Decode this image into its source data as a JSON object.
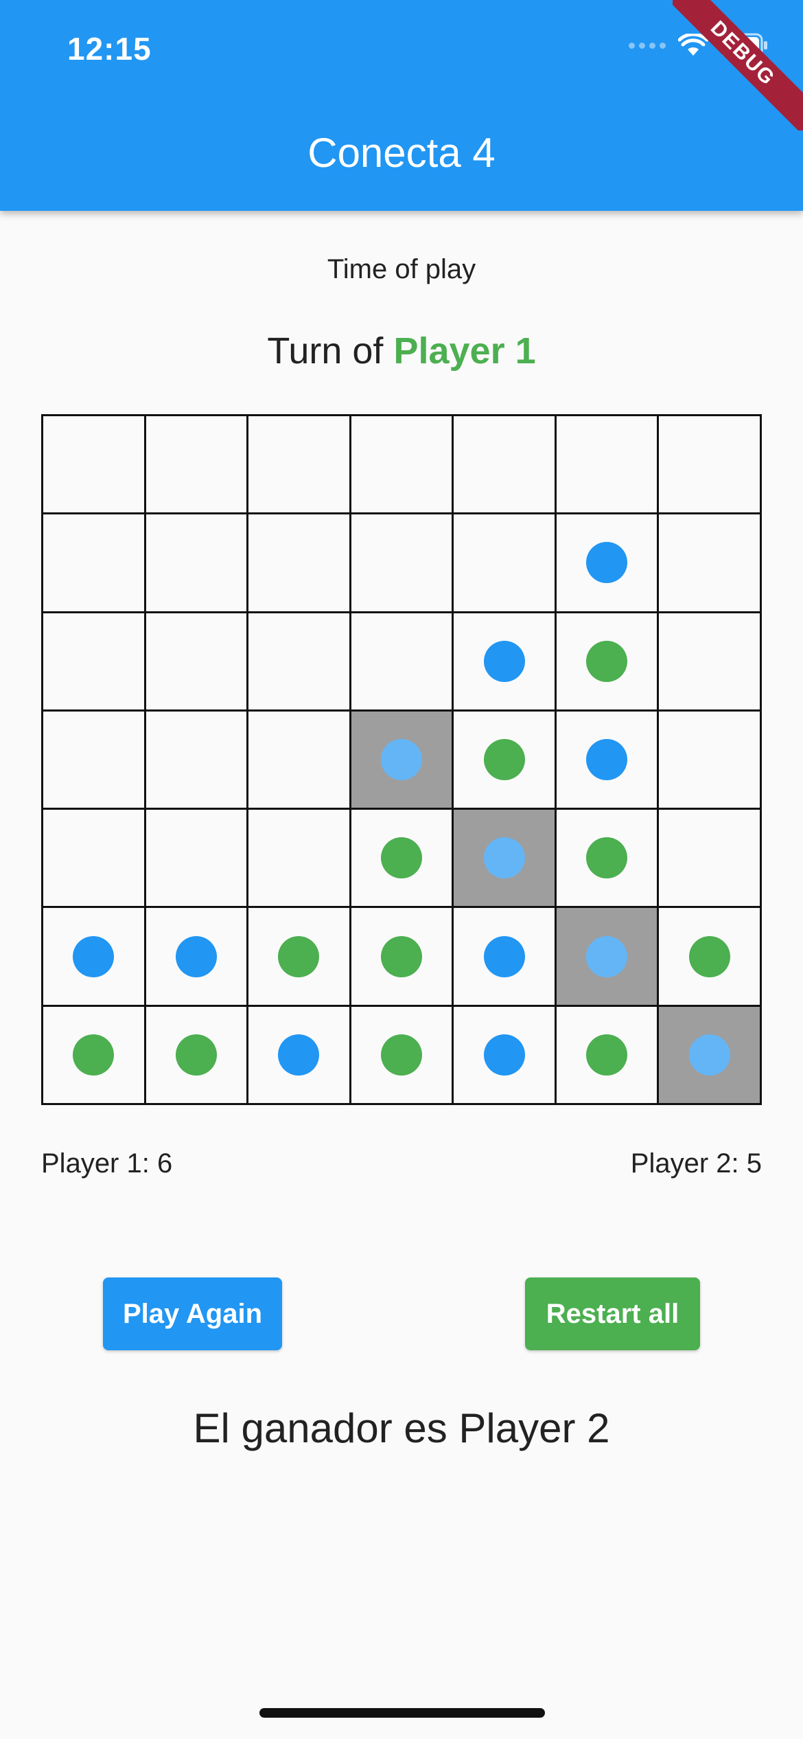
{
  "status_bar": {
    "time": "12:15"
  },
  "app_bar": {
    "title": "Conecta 4",
    "debug_label": "DEBUG",
    "color": "#2196f3"
  },
  "time_label": "Time of play",
  "turn": {
    "prefix": "Turn of",
    "player": "Player 1",
    "player_color": "#4caf50"
  },
  "board": {
    "rows": 7,
    "cols": 7,
    "colors": {
      "G": "#4caf50",
      "B": "#2196f3",
      "L": "#64b5f6",
      "win_bg": "#9e9e9e"
    },
    "grid": [
      [
        null,
        null,
        null,
        null,
        null,
        null,
        null
      ],
      [
        null,
        null,
        null,
        null,
        null,
        "B",
        null
      ],
      [
        null,
        null,
        null,
        null,
        "B",
        "G",
        null
      ],
      [
        null,
        null,
        null,
        "L",
        "G",
        "B",
        null
      ],
      [
        null,
        null,
        null,
        "G",
        "L",
        "G",
        null
      ],
      [
        "B",
        "B",
        "G",
        "G",
        "B",
        "L",
        "G"
      ],
      [
        "G",
        "G",
        "B",
        "G",
        "B",
        "G",
        "L"
      ]
    ],
    "winning_cells": [
      [
        3,
        3
      ],
      [
        4,
        4
      ],
      [
        5,
        5
      ],
      [
        6,
        6
      ]
    ]
  },
  "scores": {
    "player1": "Player 1: 6",
    "player2": "Player 2: 5"
  },
  "buttons": {
    "play_again": "Play Again",
    "restart_all": "Restart all",
    "play_again_color": "#2196f3",
    "restart_all_color": "#4caf50"
  },
  "winner_text": "El ganador es Player 2"
}
